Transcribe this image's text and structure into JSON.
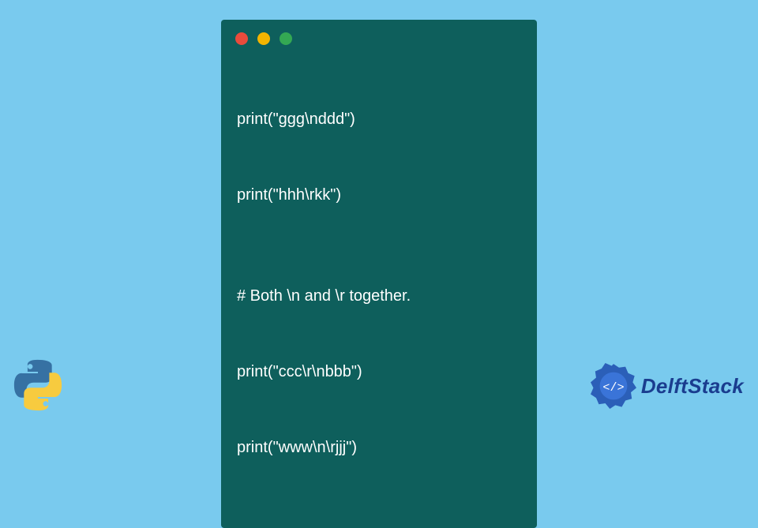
{
  "window": {
    "traffic_lights": {
      "close_color": "#e94b3c",
      "minimize_color": "#f4b400",
      "zoom_color": "#34a853"
    },
    "code_lines": [
      "print(\"ggg\\nddd\")",
      "print(\"hhh\\rkk\")",
      "",
      "# Both \\n and \\r together.",
      "print(\"ccc\\r\\nbbb\")",
      "print(\"www\\n\\rjjj\")"
    ]
  },
  "branding": {
    "site_name": "DelftStack",
    "language_icon": "python-logo"
  },
  "colors": {
    "page_bg": "#79caee",
    "window_bg": "#0e5f5c",
    "code_text": "#ffffff",
    "brand_text": "#1a3d8f"
  }
}
